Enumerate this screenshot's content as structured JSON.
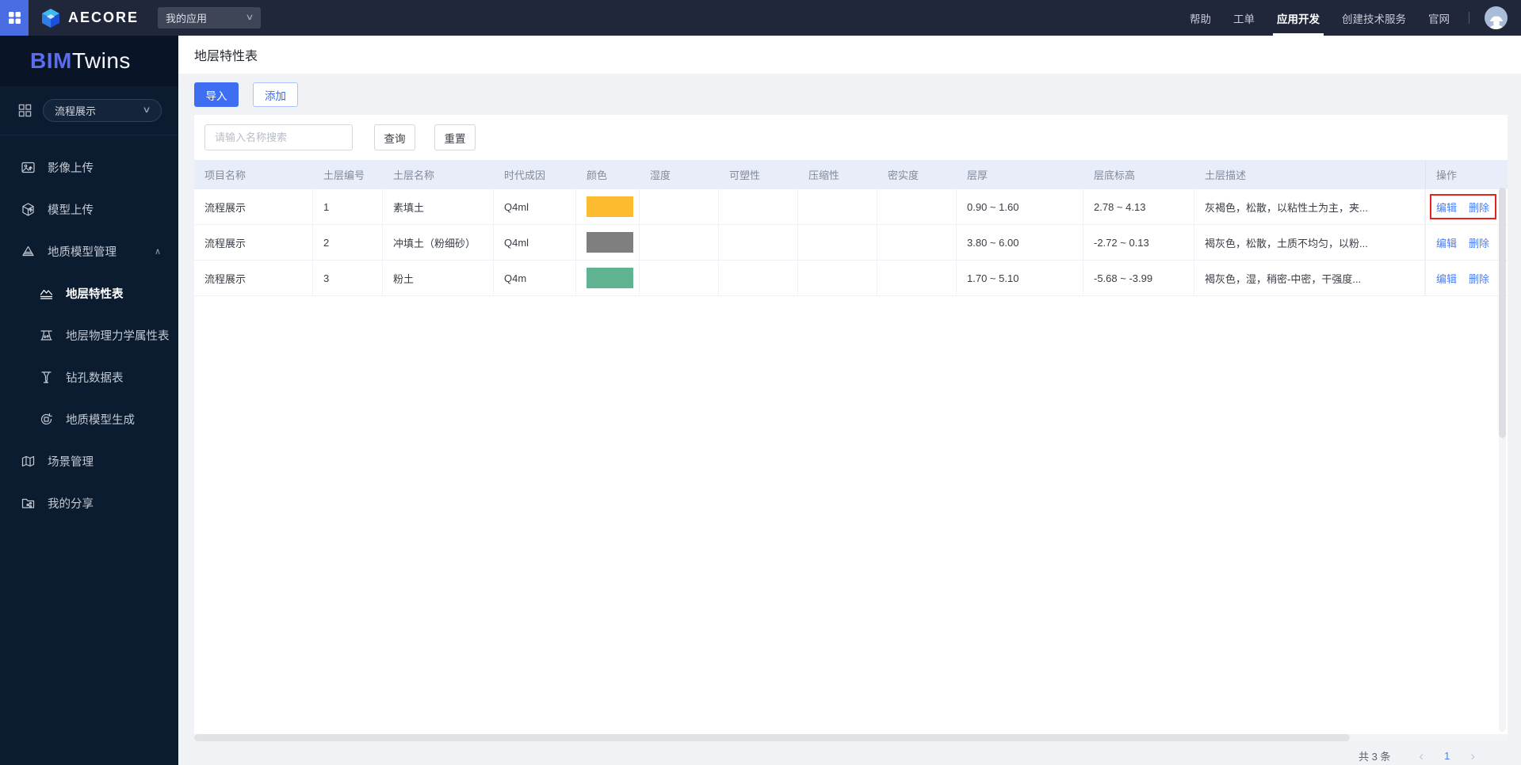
{
  "navbar": {
    "brand": "AECORE",
    "workspace_select": {
      "value": "我的应用"
    },
    "links": [
      {
        "id": "help",
        "label": "帮助",
        "active": false
      },
      {
        "id": "work-order",
        "label": "工单",
        "active": false
      },
      {
        "id": "app-dev",
        "label": "应用开发",
        "active": true
      },
      {
        "id": "create-tech-service",
        "label": "创建技术服务",
        "active": false
      },
      {
        "id": "official-site",
        "label": "官网",
        "active": false
      }
    ]
  },
  "sidebar": {
    "logo_bim": "BIM",
    "logo_twins": "Twins",
    "project_select": {
      "value": "流程展示"
    },
    "items": [
      {
        "id": "image-upload",
        "label": "影像上传",
        "icon": "image-upload-icon"
      },
      {
        "id": "model-upload",
        "label": "模型上传",
        "icon": "model-upload-icon"
      },
      {
        "id": "geo-model-manage",
        "label": "地质模型管理",
        "icon": "geology-icon",
        "expanded": true,
        "children": [
          {
            "id": "strata-table",
            "label": "地层特性表",
            "icon": "strata-icon",
            "active": true
          },
          {
            "id": "strata-physics-table",
            "label": "地层物理力学属性表",
            "icon": "physics-icon",
            "active": false
          },
          {
            "id": "borehole-table",
            "label": "钻孔数据表",
            "icon": "borehole-icon",
            "active": false
          },
          {
            "id": "geo-model-generate",
            "label": "地质模型生成",
            "icon": "generate-icon",
            "active": false
          }
        ]
      },
      {
        "id": "scene-manage",
        "label": "场景管理",
        "icon": "scene-icon"
      },
      {
        "id": "my-share",
        "label": "我的分享",
        "icon": "share-icon"
      }
    ]
  },
  "page": {
    "title": "地层特性表",
    "toolbar": {
      "import_label": "导入",
      "add_label": "添加"
    },
    "search": {
      "placeholder": "请输入名称搜索",
      "query_label": "查询",
      "reset_label": "重置"
    }
  },
  "table": {
    "columns": [
      "项目名称",
      "土层编号",
      "土层名称",
      "时代成因",
      "颜色",
      "湿度",
      "可塑性",
      "压缩性",
      "密实度",
      "层厚",
      "层底标高",
      "土层描述",
      "操作"
    ],
    "actions": {
      "edit": "编辑",
      "delete": "删除"
    },
    "rows": [
      {
        "project": "流程展示",
        "no": "1",
        "name": "素填土",
        "era": "Q4ml",
        "color": "#fdbb30",
        "humidity": "",
        "plasticity": "",
        "compressibility": "",
        "density": "",
        "thickness": "0.90 ~ 1.60",
        "elevation": "2.78 ~ 4.13",
        "desc": "灰褐色，松散，以粘性土为主，夹...",
        "highlighted": true
      },
      {
        "project": "流程展示",
        "no": "2",
        "name": "冲填土（粉细砂）",
        "era": "Q4ml",
        "color": "#7f7f7f",
        "humidity": "",
        "plasticity": "",
        "compressibility": "",
        "density": "",
        "thickness": "3.80 ~ 6.00",
        "elevation": "-2.72 ~ 0.13",
        "desc": "褐灰色，松散，土质不均匀，以粉...",
        "highlighted": false
      },
      {
        "project": "流程展示",
        "no": "3",
        "name": "粉土",
        "era": "Q4m",
        "color": "#60b391",
        "humidity": "",
        "plasticity": "",
        "compressibility": "",
        "density": "",
        "thickness": "1.70 ~ 5.10",
        "elevation": "-5.68 ~ -3.99",
        "desc": "褐灰色，湿，稍密-中密，干强度...",
        "highlighted": false
      }
    ]
  },
  "pagination": {
    "total": "共 3 条",
    "prev": "‹",
    "page": "1",
    "next": "›"
  },
  "colors": {
    "accent_blue": "#3e6ef2",
    "link_blue": "#4a7df5",
    "highlight_red": "#e42222",
    "navbar_bg": "#21273a",
    "sidebar_bg": "#0c1c30",
    "header_bg": "#e9edf9",
    "swatch_yellow": "#fdbb30",
    "swatch_gray": "#7f7f7f",
    "swatch_green": "#60b391"
  }
}
